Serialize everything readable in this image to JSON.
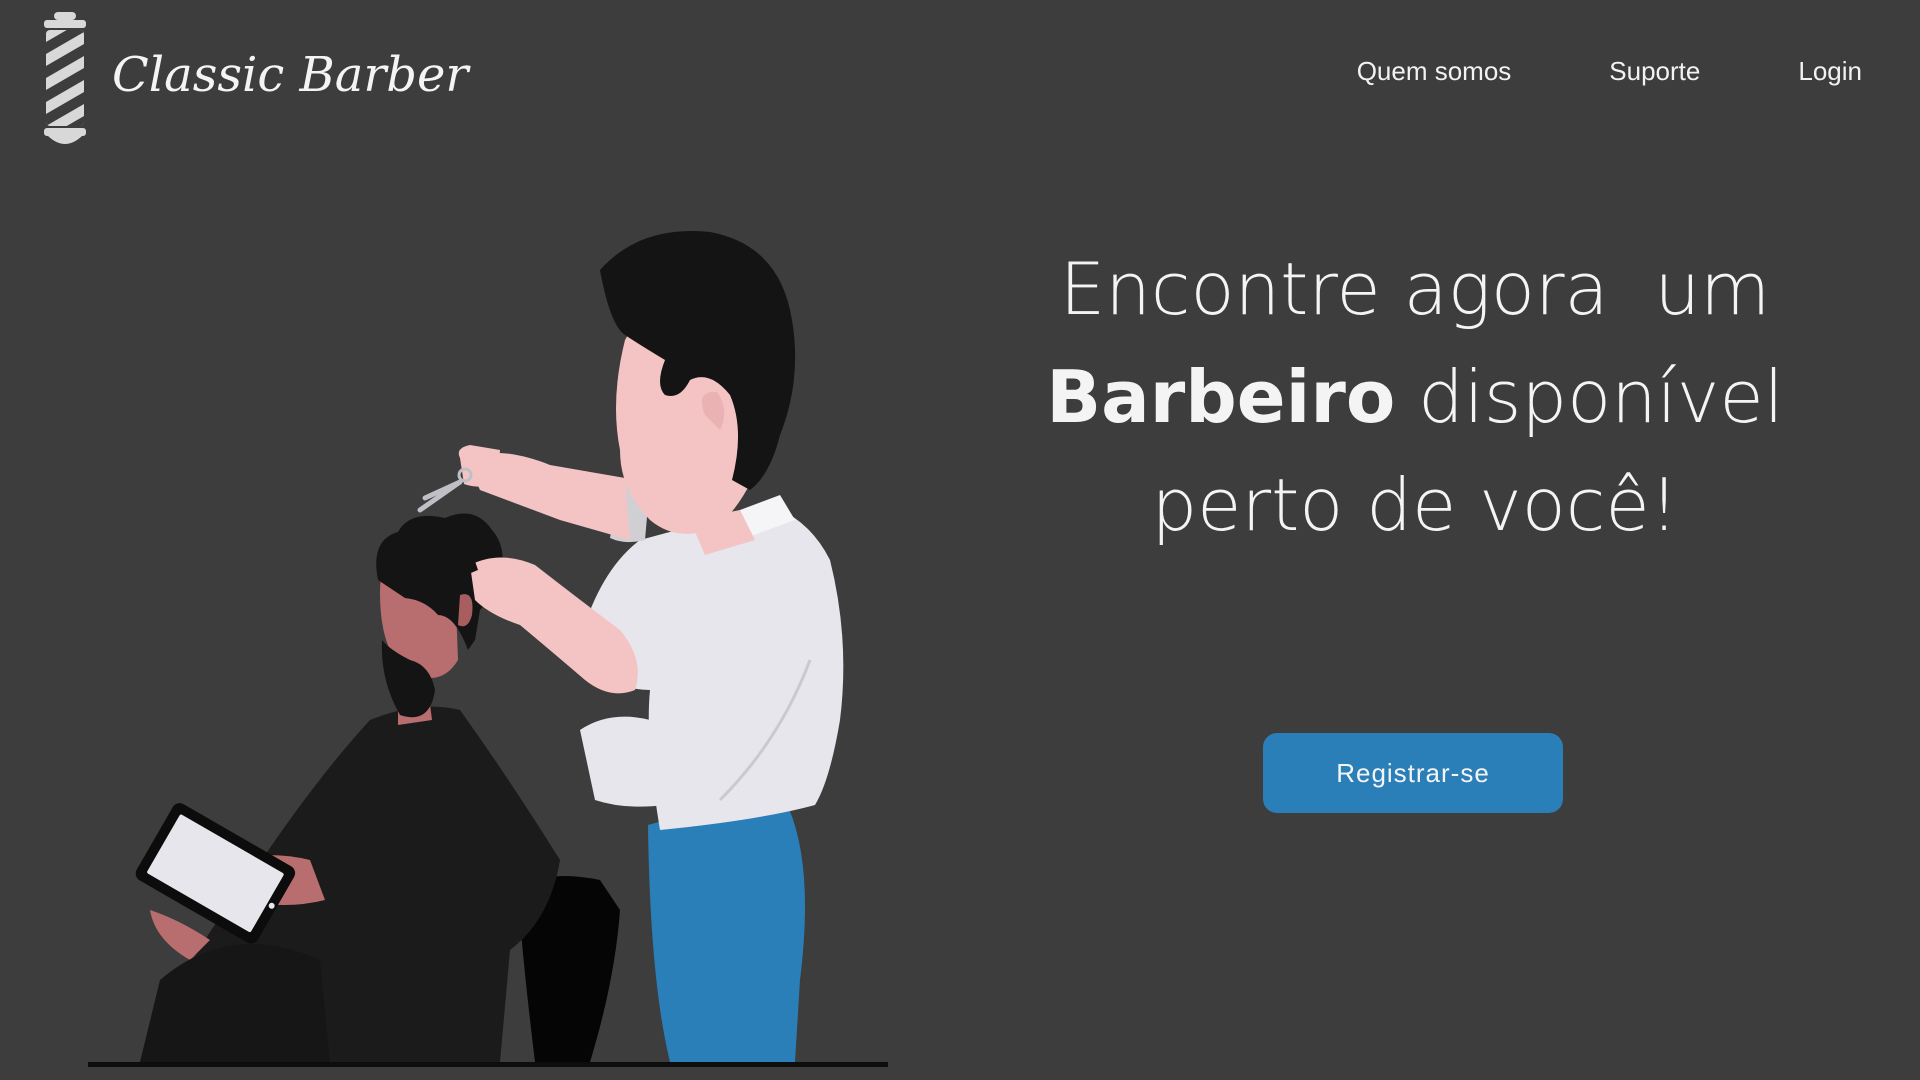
{
  "brand": {
    "name": "Classic Barber",
    "logo_icon": "barber-pole-icon"
  },
  "nav": {
    "items": [
      {
        "label": "Quem somos"
      },
      {
        "label": "Suporte"
      },
      {
        "label": "Login"
      }
    ]
  },
  "hero": {
    "line1": "Encontre agora  um",
    "line2_bold": "Barbeiro",
    "line2_rest": " disponível",
    "line3": "perto de você!"
  },
  "cta": {
    "label": "Registrar-se",
    "color": "#2a7fb8"
  },
  "colors": {
    "background": "#3d3d3d",
    "text": "#f4f4f4",
    "accent": "#2a7fb8"
  },
  "illustration": {
    "icon": "barber-cutting-hair-illustration"
  }
}
